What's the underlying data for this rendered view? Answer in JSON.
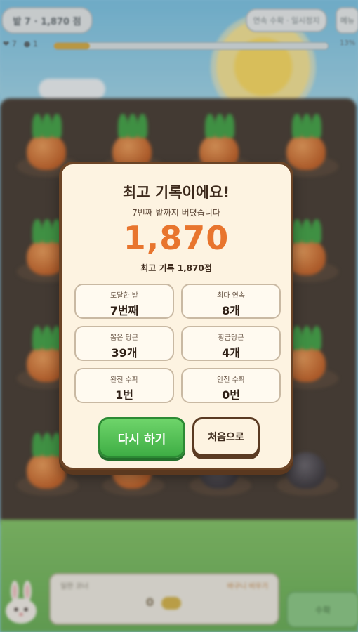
{
  "hud": {
    "stage_score": "밭 7 · 1,870 점",
    "right_pill": "연속 수확 · 일시정지",
    "menu": "메뉴",
    "lives": "❤ 7",
    "coins": "● 1",
    "progress": 0.13,
    "progress_text": "13%"
  },
  "modal": {
    "title": "최고 기록이에요!",
    "subtitle": "7번째 밭까지 버텼습니다",
    "score": "1,870",
    "best": "최고 기록 1,870점",
    "stats": [
      {
        "label": "도달한 밭",
        "value": "7번째"
      },
      {
        "label": "최다 연속",
        "value": "8개"
      },
      {
        "label": "뽑은 당근",
        "value": "39개"
      },
      {
        "label": "황금당근",
        "value": "4개"
      },
      {
        "label": "완전 수확",
        "value": "1번"
      },
      {
        "label": "안전 수확",
        "value": "0번"
      }
    ],
    "retry_label": "다시 하기",
    "home_label": "처음으로"
  },
  "basket": {
    "label_left": "일한 코너",
    "label_right": "바구니 비우기",
    "count": "0"
  },
  "side_button": "수확",
  "colors": {
    "score_orange": "#e8752e",
    "retry_green": "#3fae45",
    "modal_border": "#6b4426",
    "modal_bg": "#fdf3e1"
  }
}
